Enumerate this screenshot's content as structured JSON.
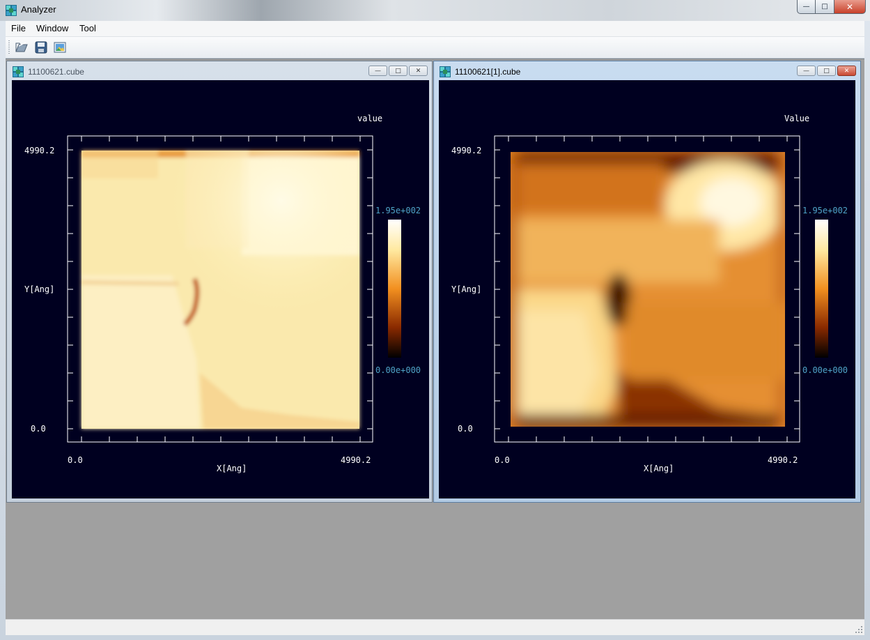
{
  "app": {
    "title": "Analyzer"
  },
  "menu": {
    "file": "File",
    "window": "Window",
    "tool": "Tool"
  },
  "toolbar": {
    "buttons": [
      "open-folder-icon",
      "save-icon",
      "image-icon"
    ]
  },
  "window_controls": {
    "minimize": "—",
    "maximize": "□",
    "close": "✕"
  },
  "child_windows": [
    {
      "title": "11100621.cube",
      "active": false,
      "plot": {
        "colorbar_title": "value",
        "colorbar_max": "1.95e+002",
        "colorbar_min": "0.00e+000",
        "y_label": "Y[Ang]",
        "x_label": "X[Ang]",
        "y_max": "4990.2",
        "y_min": "0.0",
        "x_min": "0.0",
        "x_max": "4990.2"
      }
    },
    {
      "title": "11100621[1].cube",
      "active": true,
      "plot": {
        "colorbar_title": "Value",
        "colorbar_max": "1.95e+002",
        "colorbar_min": "0.00e+000",
        "y_label": "Y[Ang]",
        "x_label": "X[Ang]",
        "y_max": "4990.2",
        "y_min": "0.0",
        "x_min": "0.0",
        "x_max": "4990.2"
      }
    }
  ],
  "colors": {
    "canvas_bg": "#000020",
    "axis": "#ffffff",
    "colorbar_label": "#4fa3c6"
  }
}
